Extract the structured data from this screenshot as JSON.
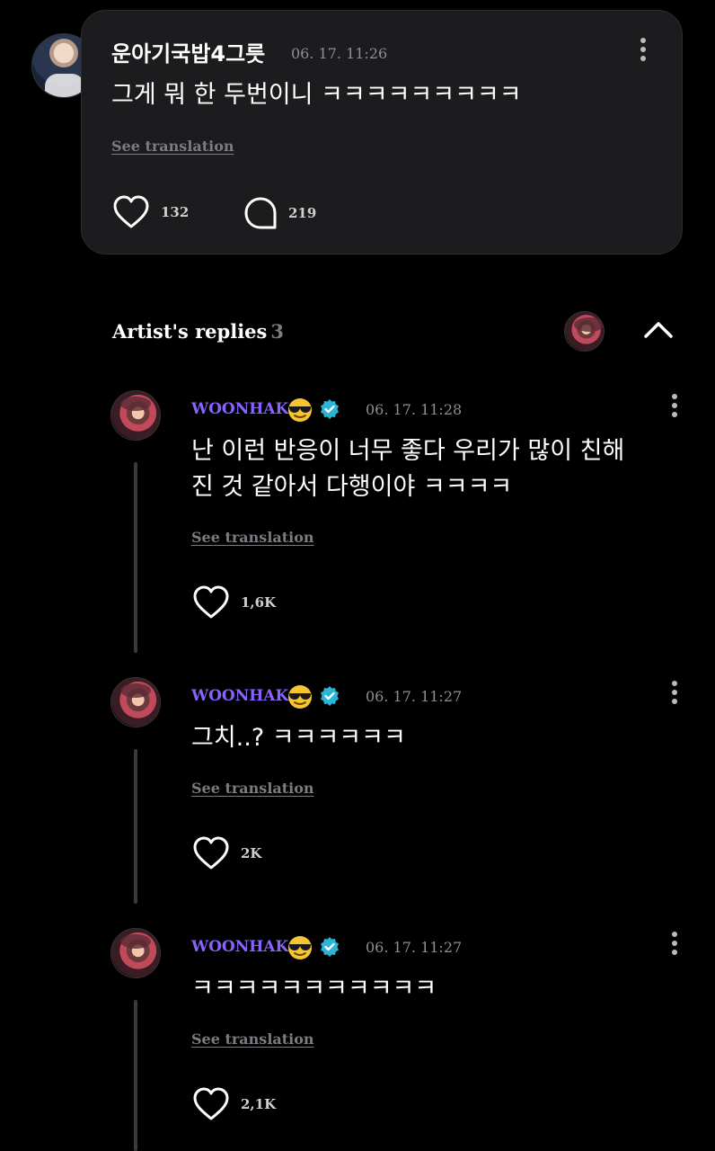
{
  "top_comment": {
    "user": "운아기국밥4그릇",
    "date": "06. 17. 11:26",
    "text": "그게 뭐 한 두번이니 ㅋㅋㅋㅋㅋㅋㅋㅋㅋ",
    "see_translation": "See translation",
    "likes": "132",
    "replies": "219"
  },
  "artist_replies": {
    "title": "Artist's replies",
    "count": "3"
  },
  "replies": [
    {
      "name": "WOONHAK",
      "date": "06. 17. 11:28",
      "text_line1": "난 이런 반응이 너무 좋다 우리가 많이 친해",
      "text_line2": "진 것 같아서 다행이야 ㅋㅋㅋㅋ",
      "see_translation": "See translation",
      "likes": "1,6K"
    },
    {
      "name": "WOONHAK",
      "date": "06. 17. 11:27",
      "text_line1": "그치..? ㅋㅋㅋㅋㅋㅋ",
      "see_translation": "See translation",
      "likes": "2K"
    },
    {
      "name": "WOONHAK",
      "date": "06. 17. 11:27",
      "text_line1": "ㅋㅋㅋㅋㅋㅋㅋㅋㅋㅋㅋ",
      "see_translation": "See translation",
      "likes": "2,1K"
    }
  ],
  "colors": {
    "background": "#000000",
    "card": "#1c1c1e",
    "artist_name": "#8a63ff",
    "verified": "#2bb4d8",
    "muted": "#8e8e93"
  }
}
